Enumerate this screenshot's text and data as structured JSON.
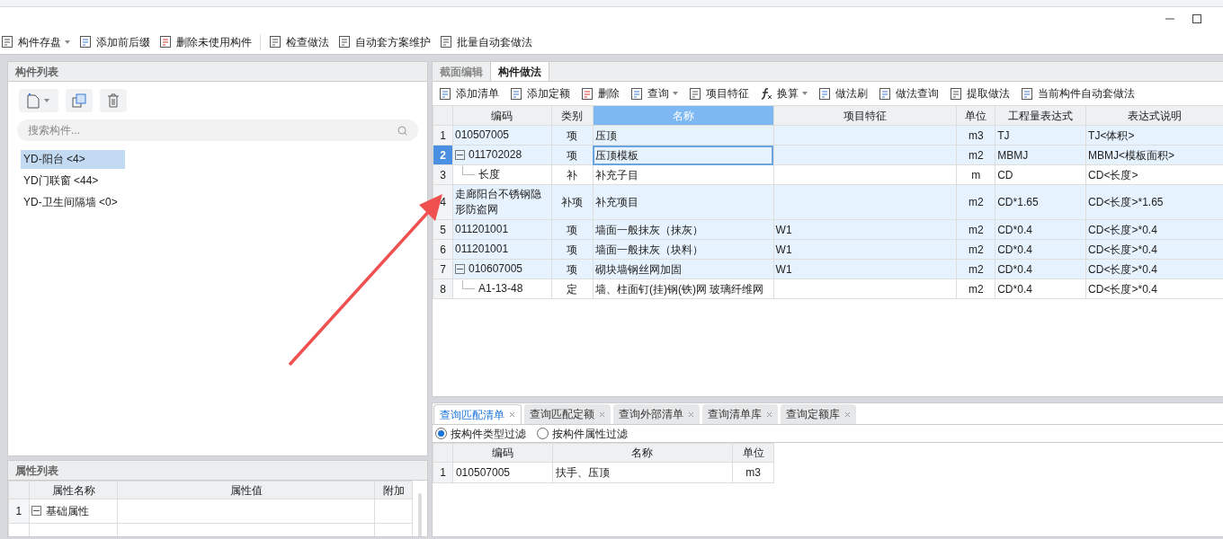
{
  "toolbar": [
    {
      "label": "构件存盘",
      "dropdown": true
    },
    {
      "label": "添加前后缀",
      "dropdown": false
    },
    {
      "label": "删除未使用构件",
      "dropdown": false
    },
    {
      "label": "检查做法",
      "dropdown": false
    },
    {
      "label": "自动套方案维护",
      "dropdown": false
    },
    {
      "label": "批量自动套做法",
      "dropdown": false
    }
  ],
  "component_list": {
    "title": "构件列表",
    "search": {
      "placeholder": "搜索构件..."
    },
    "items": [
      {
        "label": "YD-阳台 <4>",
        "selected": true
      },
      {
        "label": "YD门联窗 <44>",
        "selected": false
      },
      {
        "label": "YD-卫生间隔墙 <0>",
        "selected": false
      }
    ]
  },
  "property_list": {
    "title": "属性列表",
    "columns": [
      "属性名称",
      "属性值",
      "附加"
    ],
    "rows": [
      {
        "index": "1",
        "name": "基础属性",
        "value": "",
        "expanded": true
      }
    ]
  },
  "tabs": [
    {
      "label": "截面编辑",
      "selected": false
    },
    {
      "label": "构件做法",
      "selected": true
    }
  ],
  "method_toolbar": [
    {
      "label": "添加清单",
      "dropdown": false
    },
    {
      "label": "添加定额",
      "dropdown": false
    },
    {
      "label": "删除",
      "dropdown": false
    },
    {
      "label": "查询",
      "dropdown": true
    },
    {
      "label": "项目特征",
      "dropdown": false
    },
    {
      "label": "换算",
      "dropdown": true
    },
    {
      "label": "做法刷",
      "dropdown": false
    },
    {
      "label": "做法查询",
      "dropdown": false
    },
    {
      "label": "提取做法",
      "dropdown": false
    },
    {
      "label": "当前构件自动套做法",
      "dropdown": false
    }
  ],
  "method_table": {
    "columns": [
      {
        "label": "编码",
        "selected": false
      },
      {
        "label": "类别",
        "selected": false
      },
      {
        "label": "名称",
        "selected": true
      },
      {
        "label": "项目特征",
        "selected": false
      },
      {
        "label": "单位",
        "selected": false
      },
      {
        "label": "工程量表达式",
        "selected": false
      },
      {
        "label": "表达式说明",
        "selected": false
      }
    ],
    "rows": [
      {
        "index": "1",
        "selected": false,
        "cells": [
          "010507005",
          "项",
          "压顶",
          "",
          "m3",
          "TJ",
          "TJ<体积>"
        ]
      },
      {
        "index": "2",
        "selected": true,
        "expanded": true,
        "cells": [
          "011702028",
          "项",
          "压顶模板",
          "",
          "m2",
          "MBMJ",
          "MBMJ<模板面积>"
        ],
        "children": [
          {
            "index": "3",
            "selected": false,
            "cells": [
              "长度",
              "补",
              "补充子目",
              "",
              "m",
              "CD",
              "CD<长度>"
            ]
          }
        ]
      },
      {
        "index": "4",
        "selected": false,
        "cells": [
          "走廊阳台不锈钢隐形防盗网",
          "补项",
          "补充项目",
          "",
          "m2",
          "CD*1.65",
          "CD<长度>*1.65"
        ]
      },
      {
        "index": "5",
        "selected": false,
        "cells": [
          "011201001",
          "项",
          "墙面一般抹灰（抹灰）",
          "W1",
          "m2",
          "CD*0.4",
          "CD<长度>*0.4"
        ]
      },
      {
        "index": "6",
        "selected": false,
        "cells": [
          "011201001",
          "项",
          "墙面一般抹灰（块料）",
          "W1",
          "m2",
          "CD*0.4",
          "CD<长度>*0.4"
        ]
      },
      {
        "index": "7",
        "selected": false,
        "expanded": true,
        "cells": [
          "010607005",
          "项",
          "砌块墙钢丝网加固",
          "W1",
          "m2",
          "CD*0.4",
          "CD<长度>*0.4"
        ],
        "children": [
          {
            "index": "8",
            "selected": false,
            "cells": [
              "A1-13-48",
              "定",
              "墙、柱面钉(挂)钢(铁)网 玻璃纤维网",
              "",
              "m2",
              "CD*0.4",
              "CD<长度>*0.4"
            ]
          }
        ]
      }
    ]
  },
  "query_tabs": [
    {
      "label": "查询匹配清单",
      "selected": true
    },
    {
      "label": "查询匹配定额",
      "selected": false
    },
    {
      "label": "查询外部清单",
      "selected": false
    },
    {
      "label": "查询清单库",
      "selected": false
    },
    {
      "label": "查询定额库",
      "selected": false
    }
  ],
  "filters": [
    {
      "label": "按构件类型过滤",
      "selected": true
    },
    {
      "label": "按构件属性过滤",
      "selected": false
    }
  ],
  "query_table": {
    "columns": [
      "编码",
      "名称",
      "单位"
    ],
    "rows": [
      {
        "index": "1",
        "cells": [
          "010507005",
          "扶手、压顶",
          "m3"
        ]
      }
    ]
  }
}
